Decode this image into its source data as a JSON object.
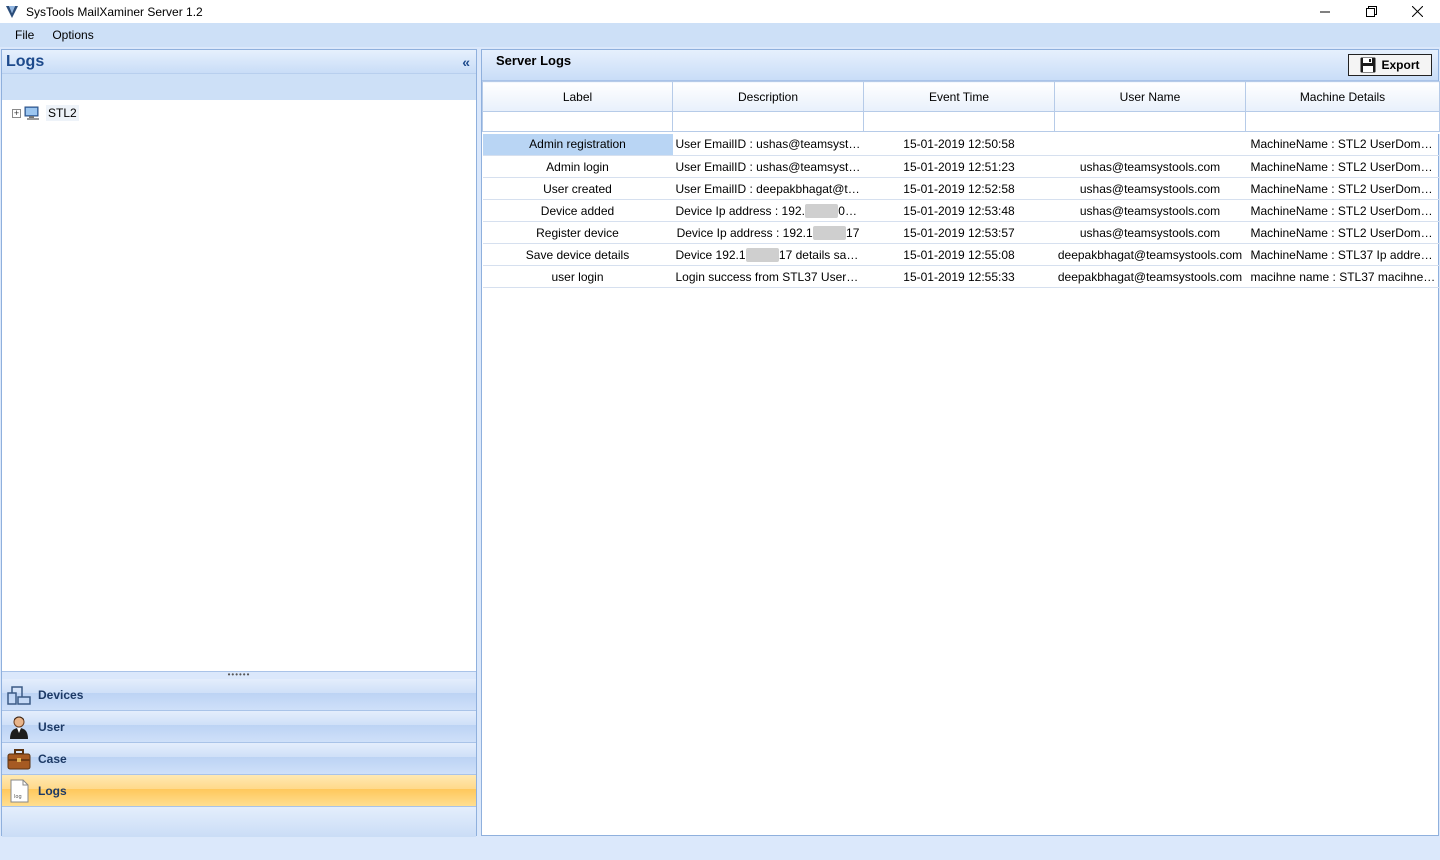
{
  "window": {
    "title": "SysTools MailXaminer Server 1.2",
    "controls": [
      "minimize",
      "restore",
      "close"
    ]
  },
  "menu": {
    "items": [
      "File",
      "Options"
    ]
  },
  "left_panel": {
    "title": "Logs",
    "collapse_glyph": "«",
    "tree": {
      "node_label": "STL2",
      "expander": "+"
    },
    "nav": [
      {
        "label": "Devices",
        "icon": "devices-icon"
      },
      {
        "label": "User",
        "icon": "user-icon"
      },
      {
        "label": "Case",
        "icon": "case-icon"
      },
      {
        "label": "Logs",
        "icon": "logs-icon",
        "active": true
      }
    ]
  },
  "right_panel": {
    "title": "Server Logs",
    "export_label": "Export",
    "columns": [
      "Label",
      "Description",
      "Event Time",
      "User Name",
      "Machine Details"
    ],
    "rows": [
      {
        "label": "Admin registration",
        "desc": "User EmailID : ushas@teamsystools....",
        "time": "15-01-2019 12:50:58",
        "user": "",
        "machine": "MachineName : STL2 UserDomainNa..."
      },
      {
        "label": "Admin login",
        "desc": "User EmailID : ushas@teamsystools.c...",
        "time": "15-01-2019 12:51:23",
        "user": "ushas@teamsystools.com",
        "machine": "MachineName : STL2 UserDomainNa..."
      },
      {
        "label": "User created",
        "desc": "User EmailID : deepakbhagat@teams...",
        "time": "15-01-2019 12:52:58",
        "user": "ushas@teamsystools.com",
        "machine": "MachineName : STL2 UserDomainNa..."
      },
      {
        "label": "Device added",
        "desc_a": "Device Ip address : 192.",
        "desc_b": "017 C...",
        "time": "15-01-2019 12:53:48",
        "user": "ushas@teamsystools.com",
        "machine": "MachineName : STL2 UserDomainNa..."
      },
      {
        "label": "Register device",
        "desc_a": "Device Ip address : 192.1",
        "desc_b": "17",
        "time": "15-01-2019 12:53:57",
        "user": "ushas@teamsystools.com",
        "machine": "MachineName : STL2 UserDomainNa..."
      },
      {
        "label": "Save device details",
        "desc_a": "Device 192.1",
        "desc_b": "17 details saved s...",
        "time": "15-01-2019 12:55:08",
        "user": "deepakbhagat@teamsystools.com",
        "machine": "MachineName : STL37 Ip address: 19..."
      },
      {
        "label": "user login",
        "desc": "Login success  from STL37 User dom...",
        "time": "15-01-2019 12:55:33",
        "user": "deepakbhagat@teamsystools.com",
        "machine": "macihne name : STL37 macihne user ..."
      }
    ]
  },
  "colors": {
    "accent": "#cde0f7",
    "header_text": "#1d4a8c",
    "active_nav": "#ffc85c"
  }
}
